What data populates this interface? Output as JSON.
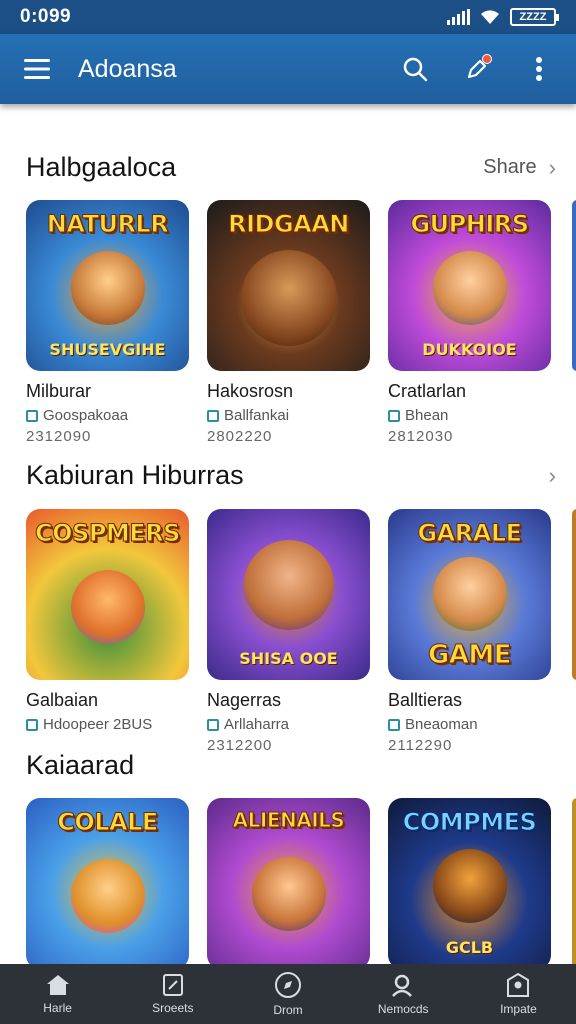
{
  "status_bar": {
    "time": "0:099",
    "battery": "ZZZZ"
  },
  "app_bar": {
    "title": "Adoansa"
  },
  "sections": [
    {
      "title": "Halbgaaloca",
      "link": "Share",
      "cards": [
        {
          "art": [
            "NATURLR",
            "SHUSEVGIHE"
          ],
          "title": "Milburar",
          "sub": "Goospakoaa",
          "num": "2312090",
          "colors": [
            "#1e4b8f",
            "#3a8ad6",
            "#f0a93a"
          ]
        },
        {
          "art": [
            "RIDGAAN",
            ""
          ],
          "title": "Hakosrosn",
          "sub": "Ballfankai",
          "num": "2802220",
          "colors": [
            "#1b1b1b",
            "#6b3a1e",
            "#d8a246"
          ]
        },
        {
          "art": [
            "GUPHIRS",
            "DUKKOIOE"
          ],
          "title": "Cratlarlan",
          "sub": "Bhean",
          "num": "2812030",
          "colors": [
            "#5b2a9c",
            "#c04bd9",
            "#f2b63a"
          ]
        }
      ]
    },
    {
      "title": "Kabiuran Hiburras",
      "link": "",
      "cards": [
        {
          "art": [
            "COSPMERS",
            ""
          ],
          "title": "Galbaian",
          "sub": "Hdoopeer 2BUS",
          "num": "",
          "colors": [
            "#3a8f3a",
            "#f2c73c",
            "#e85a2c"
          ]
        },
        {
          "art": [
            "",
            "SHISA OOE"
          ],
          "title": "Nagerras",
          "sub": "Arllaharra",
          "num": "2312200",
          "colors": [
            "#3b2a8a",
            "#8a4fd0",
            "#e8902a"
          ]
        },
        {
          "art": [
            "GARALE",
            "GAME"
          ],
          "title": "Balltieras",
          "sub": "Bneaoman",
          "num": "2112290",
          "colors": [
            "#283a8a",
            "#5a7ad8",
            "#e8b23a"
          ]
        }
      ]
    },
    {
      "title": "Kaiaarad",
      "link": "",
      "cards": [
        {
          "art": [
            "COLALE",
            ""
          ],
          "title": "",
          "sub": "",
          "num": "",
          "colors": [
            "#2b5fc2",
            "#4aa0e8",
            "#f2c23a"
          ]
        },
        {
          "art": [
            "ALIENAILS",
            ""
          ],
          "title": "",
          "sub": "",
          "num": "",
          "colors": [
            "#5b2a8a",
            "#b04bd0",
            "#f2a23a"
          ]
        },
        {
          "art": [
            "COMPMES",
            "GCLB"
          ],
          "title": "",
          "sub": "",
          "num": "",
          "colors": [
            "#0f1a3a",
            "#1e3a8a",
            "#e8902a"
          ]
        }
      ]
    }
  ],
  "bottom_nav": [
    {
      "label": "Harle",
      "icon": "home-icon"
    },
    {
      "label": "Sroeets",
      "icon": "tablet-icon"
    },
    {
      "label": "Drom",
      "icon": "compass-icon"
    },
    {
      "label": "Nemocds",
      "icon": "person-search-icon"
    },
    {
      "label": "Impate",
      "icon": "profile-icon"
    }
  ]
}
